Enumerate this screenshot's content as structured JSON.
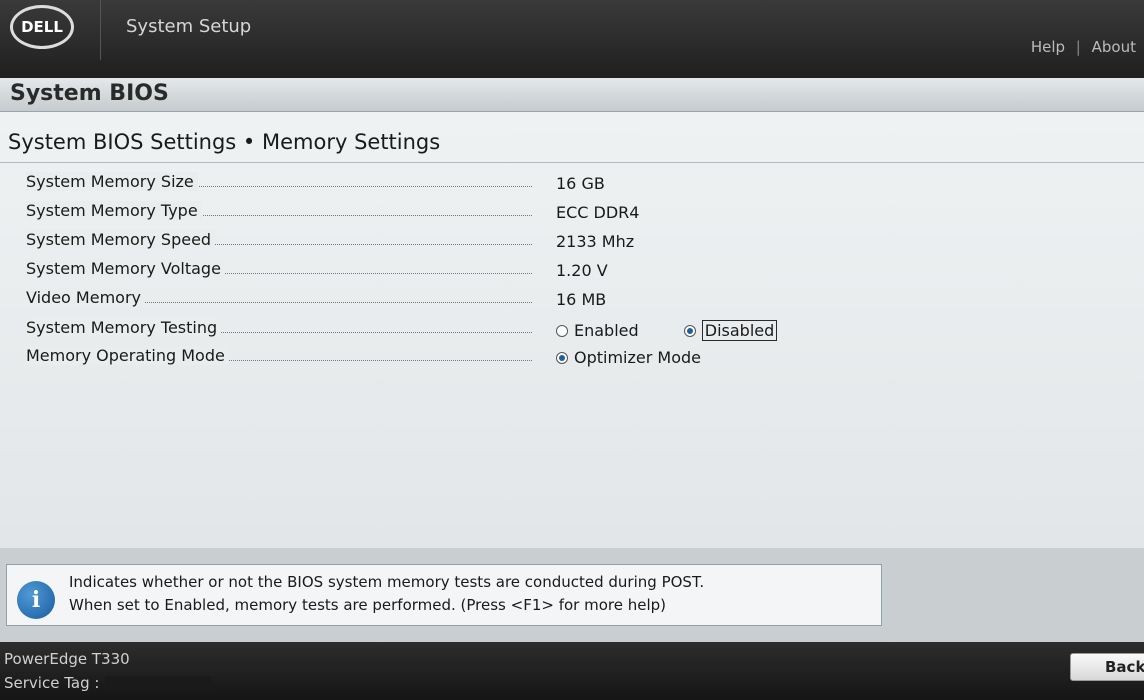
{
  "header": {
    "logo_text": "DELL",
    "app_title": "System Setup",
    "links": {
      "help": "Help",
      "separator": "|",
      "about": "About"
    }
  },
  "section": {
    "title": "System BIOS"
  },
  "page": {
    "heading": "System BIOS Settings • Memory Settings"
  },
  "settings": [
    {
      "label": "System Memory Size",
      "value": "16 GB"
    },
    {
      "label": "System Memory Type",
      "value": "ECC DDR4"
    },
    {
      "label": "System Memory Speed",
      "value": "2133 Mhz"
    },
    {
      "label": "System Memory Voltage",
      "value": "1.20 V"
    },
    {
      "label": "Video Memory",
      "value": "16 MB"
    },
    {
      "label": "System Memory Testing",
      "options": [
        {
          "label": "Enabled",
          "selected": false
        },
        {
          "label": "Disabled",
          "selected": true,
          "focused": true
        }
      ]
    },
    {
      "label": "Memory Operating Mode",
      "options": [
        {
          "label": "Optimizer Mode",
          "selected": true
        }
      ]
    }
  ],
  "help": {
    "icon": "info-icon",
    "line1": "Indicates whether or not the BIOS system memory tests are conducted during POST.",
    "line2": "When set to Enabled, memory tests are performed. (Press <F1> for more help)"
  },
  "footer": {
    "model": "PowerEdge T330",
    "service_tag_label": "Service Tag :",
    "back_label": "Back"
  },
  "colors": {
    "accent": "#1c5fa8",
    "header_bg": "#262626",
    "panel_bg": "#eaeeef"
  }
}
